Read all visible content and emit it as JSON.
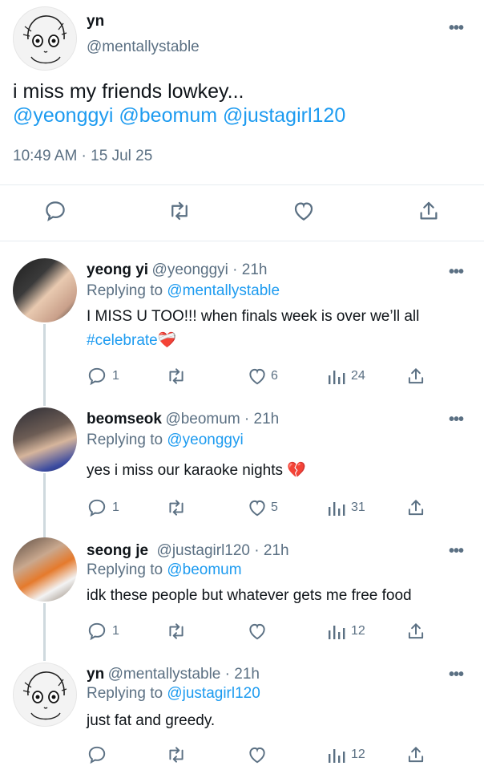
{
  "main_tweet": {
    "display_name": "yn",
    "handle": "@mentallystable",
    "text": "i miss my friends lowkey...",
    "mentions": "@yeonggyi @beomum @justagirl120",
    "timestamp": "10:49 AM · 15 Jul 25"
  },
  "replies": [
    {
      "display_name": "yeong yi",
      "meta": "@yeonggyi · 21h",
      "replying_prefix": "Replying to ",
      "replying_to": "@mentallystable",
      "text": "I MISS U TOO!!! when finals week is over we’ll all",
      "hashtag": "#celebrate",
      "emoji": "❤️‍🩹",
      "replies_count": "1",
      "likes_count": "6",
      "views_count": "24"
    },
    {
      "display_name": "beomseok",
      "meta": "@beomum · 21h",
      "replying_prefix": "Replying to ",
      "replying_to": "@yeonggyi",
      "text": "yes i miss our karaoke nights",
      "emoji": "💔",
      "replies_count": "1",
      "likes_count": "5",
      "views_count": "31"
    },
    {
      "display_name": "seong je",
      "meta": "@justagirl120 · 21h",
      "replying_prefix": "Replying to ",
      "replying_to": "@beomum",
      "text": "idk these people but whatever gets me free food",
      "replies_count": "1",
      "likes_count": "",
      "views_count": "12"
    },
    {
      "display_name": "yn",
      "meta": "@mentallystable · 21h",
      "replying_prefix": "Replying to ",
      "replying_to": "@justagirl120",
      "text": "just fat and greedy.",
      "replies_count": "",
      "likes_count": "",
      "views_count": "12"
    }
  ],
  "more_label": "•••",
  "colors": {
    "link": "#1d9bf0",
    "secondary": "#5b7083",
    "broken_heart": "#e0245e"
  }
}
